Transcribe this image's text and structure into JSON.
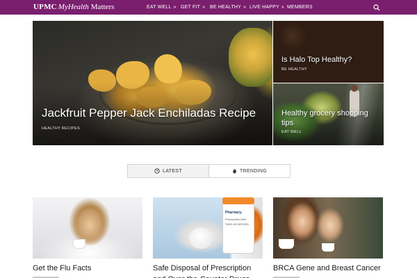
{
  "nav": {
    "brand_upmc": "UPMC",
    "brand_my_health": "MyHealth",
    "brand_matters": "Matters",
    "items": [
      {
        "label": "EAT WELL",
        "chevron": "»"
      },
      {
        "label": "GET FIT",
        "chevron": "»"
      },
      {
        "label": "BE HEALTHY",
        "chevron": "»"
      },
      {
        "label": "LIVE HAPPY",
        "chevron": "»"
      },
      {
        "label": "MEMBERS",
        "chevron": ""
      }
    ],
    "search_icon": "search-icon",
    "color": "#7a1f6e"
  },
  "hero": {
    "main": {
      "title": "Jackfruit Pepper Jack Enchiladas Recipe",
      "tag": "HEALTHY RECIPES"
    },
    "side": [
      {
        "title": "Is Halo Top Healthy?",
        "tag": "BE HEALTHY"
      },
      {
        "title": "Healthy grocery shopping tips",
        "tag": "EAT WELL"
      }
    ]
  },
  "tabs": [
    {
      "label": "LATEST",
      "icon": "clock-icon",
      "active": true
    },
    {
      "label": "TRENDING",
      "icon": "flame-icon",
      "active": false
    }
  ],
  "articles": [
    {
      "title": "Get the Flu Facts"
    },
    {
      "title": "Safe Disposal of Prescription and Over-the-Counter Drugs"
    },
    {
      "title": "BRCA Gene and Breast Cancer"
    }
  ],
  "pharmacy_label": "Pharmacy",
  "prescription_label": "Prescription Med",
  "take_as_needed": "TAKE AS NEEDED"
}
